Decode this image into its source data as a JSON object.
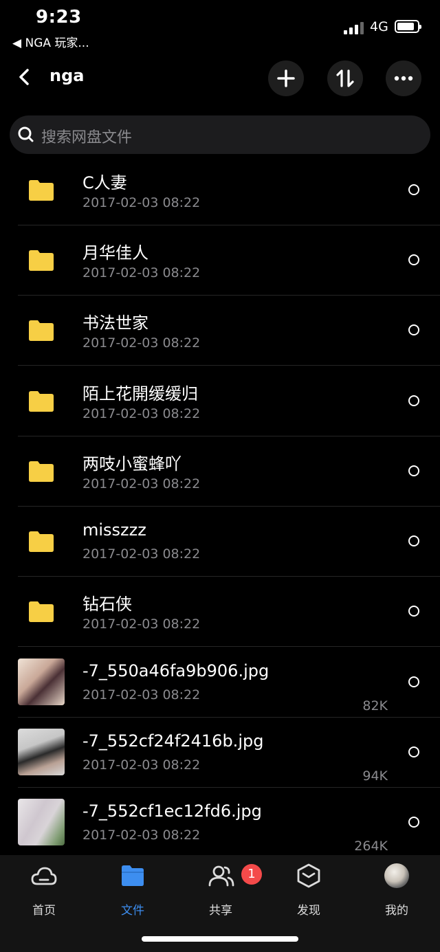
{
  "status": {
    "time": "9:23",
    "back_app": "◀ NGA 玩家...",
    "network": "4G"
  },
  "header": {
    "title": "nga"
  },
  "search": {
    "placeholder": "搜索网盘文件"
  },
  "files": [
    {
      "name": "C人妻",
      "date": "2017-02-03 08:22",
      "size": "",
      "type": "folder"
    },
    {
      "name": "月华佳人",
      "date": "2017-02-03 08:22",
      "size": "",
      "type": "folder"
    },
    {
      "name": "书法世家",
      "date": "2017-02-03 08:22",
      "size": "",
      "type": "folder"
    },
    {
      "name": "陌上花開缓缓归",
      "date": "2017-02-03 08:22",
      "size": "",
      "type": "folder"
    },
    {
      "name": "两吱小蜜蜂吖",
      "date": "2017-02-03 08:22",
      "size": "",
      "type": "folder"
    },
    {
      "name": "misszzz",
      "date": "2017-02-03 08:22",
      "size": "",
      "type": "folder"
    },
    {
      "name": "钻石侠",
      "date": "2017-02-03 08:22",
      "size": "",
      "type": "folder"
    },
    {
      "name": "-7_550a46fa9b906.jpg",
      "date": "2017-02-03 08:22",
      "size": "82K",
      "type": "image"
    },
    {
      "name": "-7_552cf24f2416b.jpg",
      "date": "2017-02-03 08:22",
      "size": "94K",
      "type": "image"
    },
    {
      "name": "-7_552cf1ec12fd6.jpg",
      "date": "2017-02-03 08:22",
      "size": "264K",
      "type": "image"
    }
  ],
  "tabs": [
    {
      "label": "首页",
      "icon": "cloud-icon"
    },
    {
      "label": "文件",
      "icon": "folder-icon"
    },
    {
      "label": "共享",
      "icon": "people-icon",
      "badge": "1"
    },
    {
      "label": "发现",
      "icon": "cube-icon"
    },
    {
      "label": "我的",
      "icon": "avatar"
    }
  ],
  "colors": {
    "accent": "#3d8ef0",
    "folder": "#f7cf45",
    "badge": "#f44a4a",
    "background": "#000000"
  }
}
